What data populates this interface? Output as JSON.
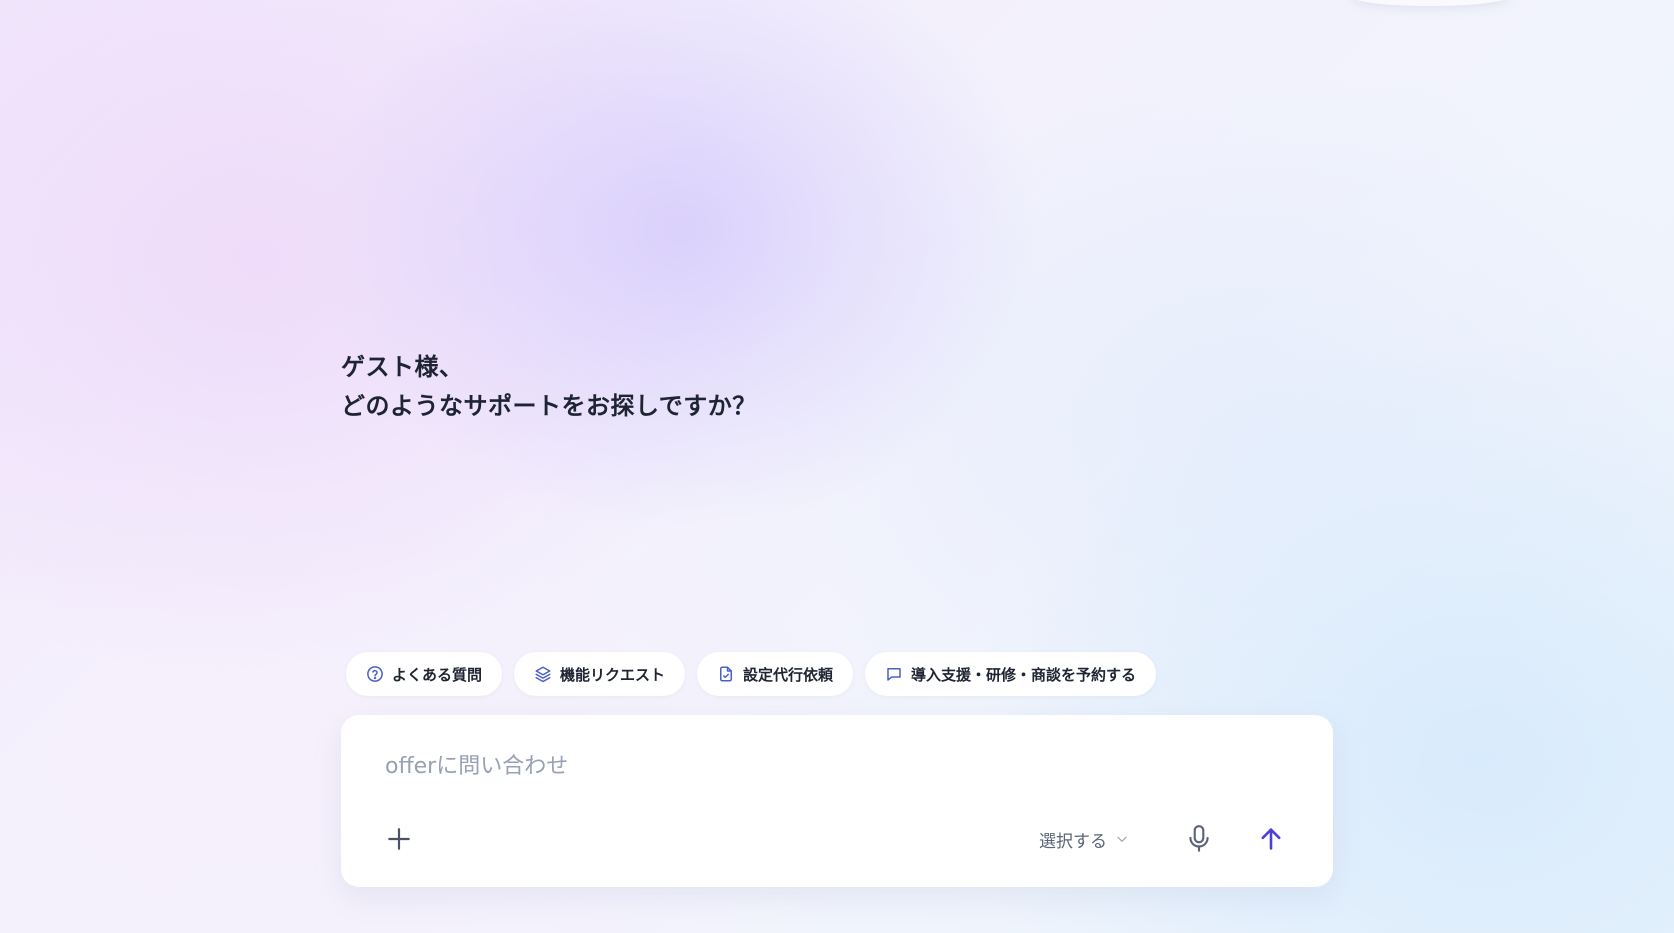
{
  "greeting": {
    "line1": "ゲスト様、",
    "line2": "どのようなサポートをお探しですか？"
  },
  "chips": [
    {
      "label": "よくある質問",
      "icon": "question-circle-icon"
    },
    {
      "label": "機能リクエスト",
      "icon": "layers-icon"
    },
    {
      "label": "設定代行依頼",
      "icon": "document-check-icon"
    },
    {
      "label": "導入支援・研修・商談を予約する",
      "icon": "chat-bubble-icon"
    }
  ],
  "composer": {
    "placeholder": "offerに問い合わせ",
    "select_label": "選択する",
    "add_icon": "plus-icon",
    "mic_icon": "microphone-icon",
    "send_icon": "arrow-up-icon"
  },
  "colors": {
    "accent": "#4a3fd8",
    "chip_icon": "#4a5fc8",
    "text": "#1f2433",
    "muted": "#98a0b4"
  }
}
